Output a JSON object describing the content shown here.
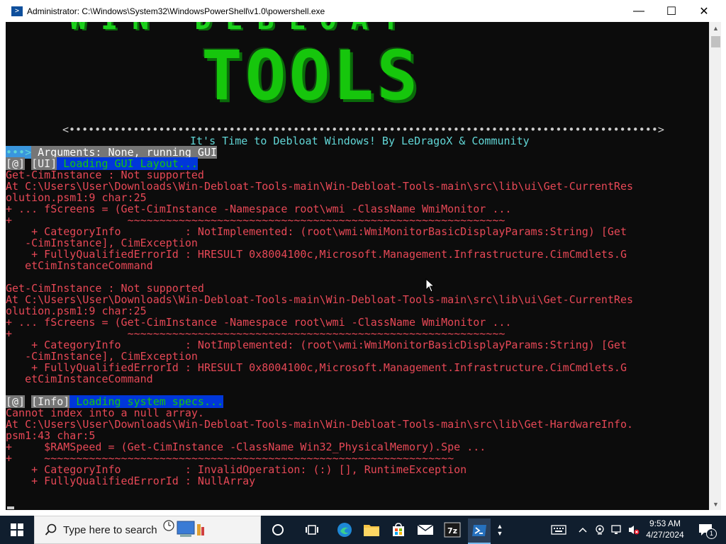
{
  "window": {
    "title": "Administrator: C:\\Windows\\System32\\WindowsPowerShell\\v1.0\\powershell.exe",
    "minimize_glyph": "—",
    "maximize_glyph": "☐",
    "close_glyph": "✕"
  },
  "banner": {
    "title": "TOOLS",
    "top_art": "WIN  DEBLOAT",
    "divider": "<••••••••••••••••••••••••••••••••••••••••••••••••••••••••••••••••••••••••••••••••••••••••••••>",
    "subtitle": "It's Time to Debloat Windows! By LeDragoX & Community"
  },
  "console": {
    "args_tag": "•••>",
    "args_text": " Arguments: None, running GUI",
    "ui_tag1": "[@]",
    "ui_tag2": "[UI]",
    "ui_msg": " Loading GUI Layout...",
    "err1": [
      "Get-CimInstance : Not supported",
      "At C:\\Users\\User\\Downloads\\Win-Debloat-Tools-main\\Win-Debloat-Tools-main\\src\\lib\\ui\\Get-CurrentRes",
      "olution.psm1:9 char:25",
      "+ ... fScreens = (Get-CimInstance -Namespace root\\wmi -ClassName WmiMonitor ...",
      "+                  ~~~~~~~~~~~~~~~~~~~~~~~~~~~~~~~~~~~~~~~~~~~~~~~~~~~~~~~~~~~",
      "    + CategoryInfo          : NotImplemented: (root\\wmi:WmiMonitorBasicDisplayParams:String) [Get",
      "   -CimInstance], CimException",
      "    + FullyQualifiedErrorId : HRESULT 0x8004100c,Microsoft.Management.Infrastructure.CimCmdlets.G",
      "   etCimInstanceCommand"
    ],
    "err2": [
      "Get-CimInstance : Not supported",
      "At C:\\Users\\User\\Downloads\\Win-Debloat-Tools-main\\Win-Debloat-Tools-main\\src\\lib\\ui\\Get-CurrentRes",
      "olution.psm1:9 char:25",
      "+ ... fScreens = (Get-CimInstance -Namespace root\\wmi -ClassName WmiMonitor ...",
      "+                  ~~~~~~~~~~~~~~~~~~~~~~~~~~~~~~~~~~~~~~~~~~~~~~~~~~~~~~~~~~~",
      "    + CategoryInfo          : NotImplemented: (root\\wmi:WmiMonitorBasicDisplayParams:String) [Get",
      "   -CimInstance], CimException",
      "    + FullyQualifiedErrorId : HRESULT 0x8004100c,Microsoft.Management.Infrastructure.CimCmdlets.G",
      "   etCimInstanceCommand"
    ],
    "info_tag1": "[@]",
    "info_tag2": "[Info]",
    "info_msg": " Loading system specs...",
    "err3": [
      "Cannot index into a null array.",
      "At C:\\Users\\User\\Downloads\\Win-Debloat-Tools-main\\Win-Debloat-Tools-main\\src\\lib\\Get-HardwareInfo.",
      "psm1:43 char:5",
      "+     $RAMSpeed = (Get-CimInstance -ClassName Win32_PhysicalMemory).Spe ...",
      "+     ~~~~~~~~~~~~~~~~~~~~~~~~~~~~~~~~~~~~~~~~~~~~~~~~~~~~~~~~~~~~~~~~",
      "    + CategoryInfo          : InvalidOperation: (:) [], RuntimeException",
      "    + FullyQualifiedErrorId : NullArray"
    ]
  },
  "taskbar": {
    "search_placeholder": "Type here to search",
    "time": "9:53 AM",
    "date": "4/27/2024",
    "notification_count": "1",
    "colors": {
      "bg": "#101e2e",
      "accent": "#0078d7"
    }
  },
  "colors": {
    "console_bg": "#0c0c0c",
    "error_red": "#e74856",
    "banner_green": "#16c60c",
    "subtitle_cyan": "#61d6d6"
  }
}
